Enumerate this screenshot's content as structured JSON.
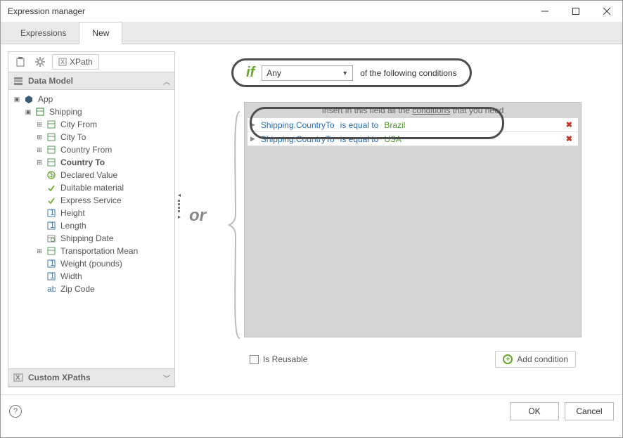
{
  "window": {
    "title": "Expression manager"
  },
  "tabs": {
    "expressions": "Expressions",
    "new": "New"
  },
  "toolbar": {
    "xpath": "XPath"
  },
  "sections": {
    "datamodel": "Data Model",
    "custom": "Custom XPaths"
  },
  "tree": {
    "app": "App",
    "shipping": "Shipping",
    "items": [
      "City From",
      "City To",
      "Country From",
      "Country To",
      "Declared Value",
      "Duitable material",
      "Express Service",
      "Height",
      "Length",
      "Shipping Date",
      "Transportation Mean",
      "Weight (pounds)",
      "Width",
      "Zip Code"
    ]
  },
  "builder": {
    "if": "if",
    "mode": "Any",
    "suffix": "of the following conditions",
    "hint_pre": "Insert in this field all the ",
    "hint_mid": "conditions",
    "hint_post": " that you need",
    "or": "or",
    "reusable": "Is Reusable",
    "add": "Add condition",
    "conds": [
      {
        "attr": "Shipping.CountryTo",
        "op": "is equal to",
        "val": "Brazil"
      },
      {
        "attr": "Shipping.CountryTo",
        "op": "is equal to",
        "val": "USA"
      }
    ]
  },
  "footer": {
    "ok": "OK",
    "cancel": "Cancel"
  }
}
